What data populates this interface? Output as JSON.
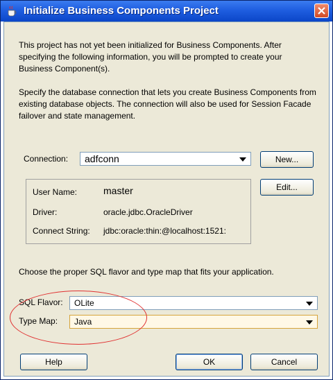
{
  "window": {
    "title": "Initialize Business Components Project",
    "close_label": "×"
  },
  "intro": {
    "para1": "This project has not yet been initialized for Business Components.  After specifying the following information, you will be prompted to create your Business Component(s).",
    "para2": "Specify the database connection that lets you create Business Components from existing database objects.  The connection will also be used for Session Facade failover and state management."
  },
  "connection": {
    "label": "Connection:",
    "value": "adfconn",
    "new_button": "New...",
    "edit_button": "Edit...",
    "info": [
      {
        "label": "User Name:",
        "value": "master"
      },
      {
        "label": "Driver:",
        "value": "oracle.jdbc.OracleDriver"
      },
      {
        "label": "Connect String:",
        "value": "jdbc:oracle:thin:@localhost:1521:"
      }
    ]
  },
  "sql": {
    "instruction": "Choose the proper SQL flavor and type map that fits your application.",
    "flavor_label": "SQL Flavor:",
    "flavor_value": "OLite",
    "typemap_label": "Type Map:",
    "typemap_value": "Java"
  },
  "buttons": {
    "help": "Help",
    "ok": "OK",
    "cancel": "Cancel"
  },
  "colors": {
    "titlebar": "#1f5ee0",
    "client_bg": "#ece9d8",
    "highlight_oval": "#e03030"
  }
}
